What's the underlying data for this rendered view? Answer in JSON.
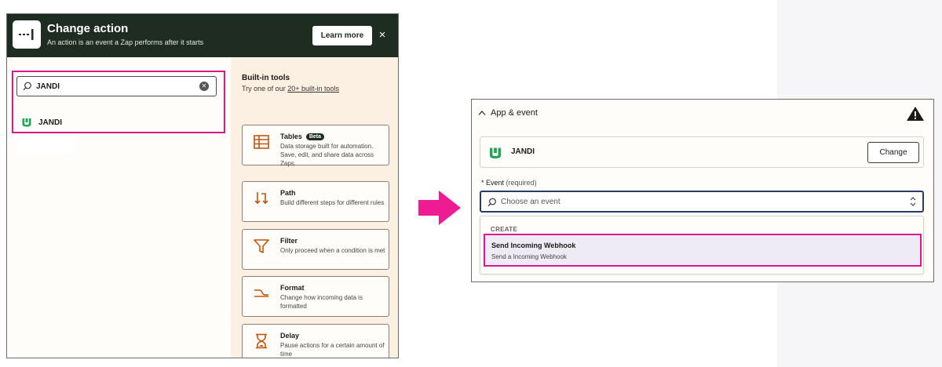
{
  "modal": {
    "title": "Change action",
    "subtitle": "An action is an event a Zap performs after it starts",
    "learn_more": "Learn more",
    "close": "×"
  },
  "search": {
    "value": "JANDI",
    "result_label": "JANDI"
  },
  "builtin": {
    "title": "Built-in tools",
    "sub_prefix": "Try one of our ",
    "sub_link": "20+ built-in tools",
    "tools": [
      {
        "name": "Tables",
        "badge": "Beta",
        "desc": "Data storage built for automation. Save, edit, and share data across Zaps."
      },
      {
        "name": "Path",
        "desc": "Build different steps for different rules"
      },
      {
        "name": "Filter",
        "desc": "Only proceed when a condition is met"
      },
      {
        "name": "Format",
        "desc": "Change how incoming data is formatted"
      },
      {
        "name": "Delay",
        "desc": "Pause actions for a certain amount of time"
      }
    ]
  },
  "panel": {
    "title": "App & event",
    "app_name": "JANDI",
    "change": "Change",
    "event_label": "* Event",
    "event_required": "(required)",
    "event_placeholder": "Choose an event",
    "section": "CREATE",
    "option_title": "Send Incoming Webhook",
    "option_sub": "Send a Incoming Webhook"
  },
  "colors": {
    "header_bg": "#1f2c22",
    "highlight": "#d9188b",
    "tools_bg": "#fcf0e2",
    "tool_icon": "#c2540f",
    "jandi_green": "#22a45d"
  }
}
